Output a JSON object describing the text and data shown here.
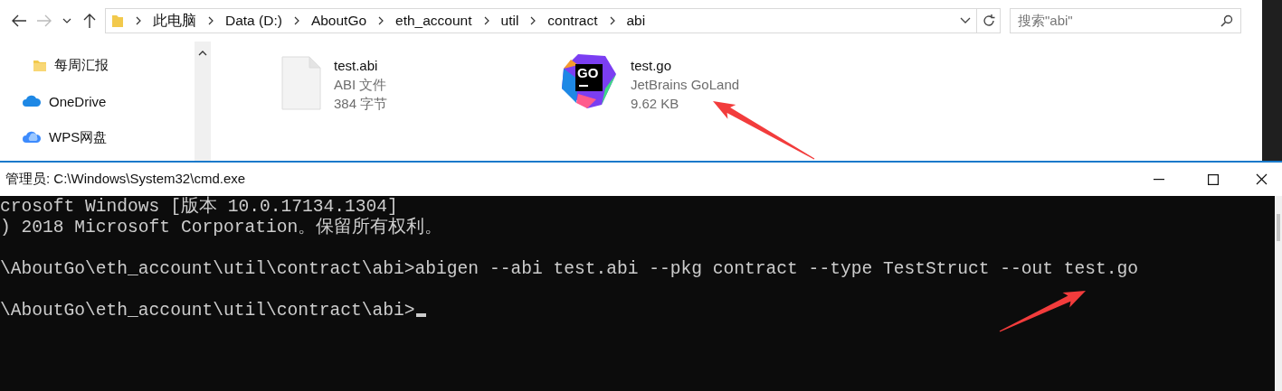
{
  "explorer": {
    "address_segments": [
      "此电脑",
      "Data (D:)",
      "AboutGo",
      "eth_account",
      "util",
      "contract",
      "abi"
    ],
    "search": {
      "placeholder": "搜索\"abi\""
    },
    "sidebar": {
      "items": [
        {
          "label": "每周汇报",
          "kind": "folder"
        },
        {
          "label": "OneDrive",
          "kind": "cloud"
        },
        {
          "label": "WPS网盘",
          "kind": "wps"
        }
      ]
    },
    "files": [
      {
        "name": "test.abi",
        "type": "ABI 文件",
        "size": "384 字节",
        "kind": "blank"
      },
      {
        "name": "test.go",
        "type": "JetBrains GoLand",
        "size": "9.62 KB",
        "kind": "goland",
        "icon_text": "GO"
      }
    ]
  },
  "console": {
    "title": "管理员: C:\\Windows\\System32\\cmd.exe",
    "blocks": [
      [
        "crosoft Windows [版本 10.0.17134.1304]",
        ") 2018 Microsoft Corporation。保留所有权利。"
      ],
      [
        "\\AboutGo\\eth_account\\util\\contract\\abi>abigen --abi test.abi --pkg contract --type TestStruct --out test.go"
      ],
      [
        "\\AboutGo\\eth_account\\util\\contract\\abi>"
      ]
    ],
    "cursor": true
  }
}
